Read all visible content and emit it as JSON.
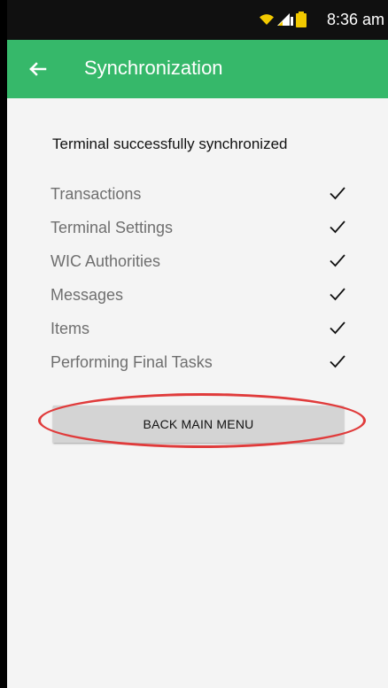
{
  "status_bar": {
    "time": "8:36 am",
    "icons": [
      "wifi-icon",
      "signal-icon",
      "battery-icon"
    ]
  },
  "app_bar": {
    "title": "Synchronization",
    "back_icon": "back-arrow-icon",
    "color": "#36b86a"
  },
  "main": {
    "summary": "Terminal successfully synchronized",
    "tasks": [
      {
        "label": "Transactions",
        "status_icon": "checkmark-icon"
      },
      {
        "label": "Terminal Settings",
        "status_icon": "checkmark-icon"
      },
      {
        "label": "WIC Authorities",
        "status_icon": "checkmark-icon"
      },
      {
        "label": "Messages",
        "status_icon": "checkmark-icon"
      },
      {
        "label": "Items",
        "status_icon": "checkmark-icon"
      },
      {
        "label": "Performing Final Tasks",
        "status_icon": "checkmark-icon"
      }
    ],
    "button_label": "BACK MAIN MENU"
  },
  "colors": {
    "status_bar": "#101010",
    "background": "#f4f4f4",
    "button": "#d4d4d4",
    "annotation": "#e03b3b"
  }
}
